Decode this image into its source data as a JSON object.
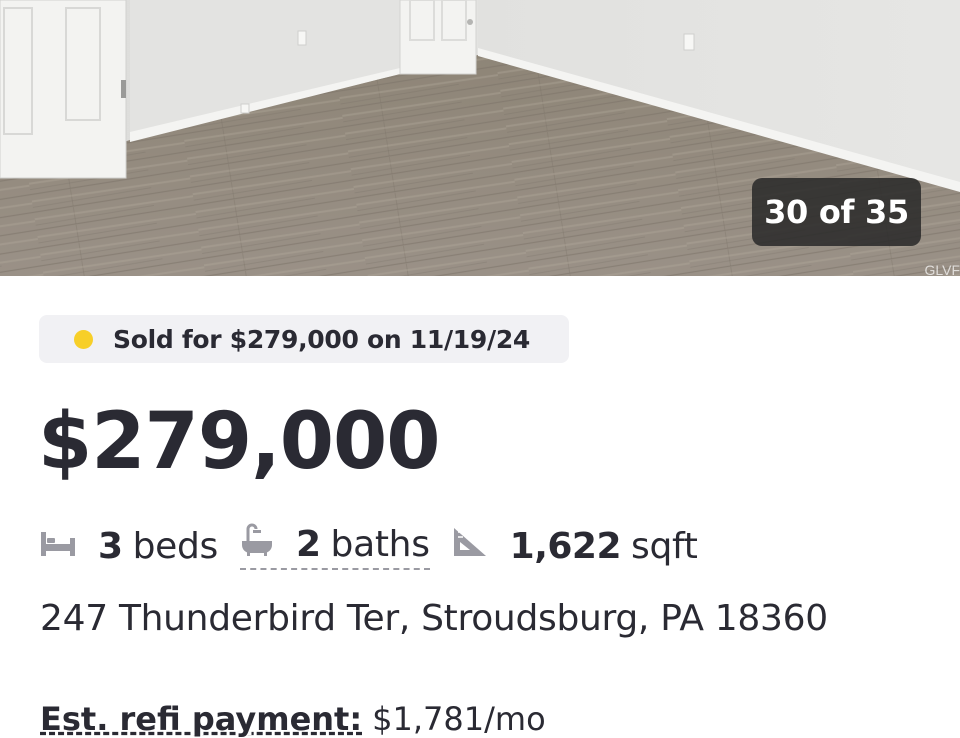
{
  "photo": {
    "counter": "30 of 35",
    "watermark": "GLVF"
  },
  "listing": {
    "sold_badge": "Sold for $279,000 on 11/19/24",
    "status_color": "#f7cf28",
    "price": "$279,000",
    "facts": {
      "beds_num": "3",
      "beds_unit": "beds",
      "baths_num": "2",
      "baths_unit": "baths",
      "sqft_num": "1,622",
      "sqft_unit": "sqft"
    },
    "address": "247 Thunderbird Ter, Stroudsburg, PA 18360",
    "est_payment_label": "Est. refi payment:",
    "est_payment_value": "$1,781/mo"
  },
  "icons": {
    "beds": "bed-icon",
    "baths": "bathtub-icon",
    "sqft": "ruler-triangle-icon"
  }
}
